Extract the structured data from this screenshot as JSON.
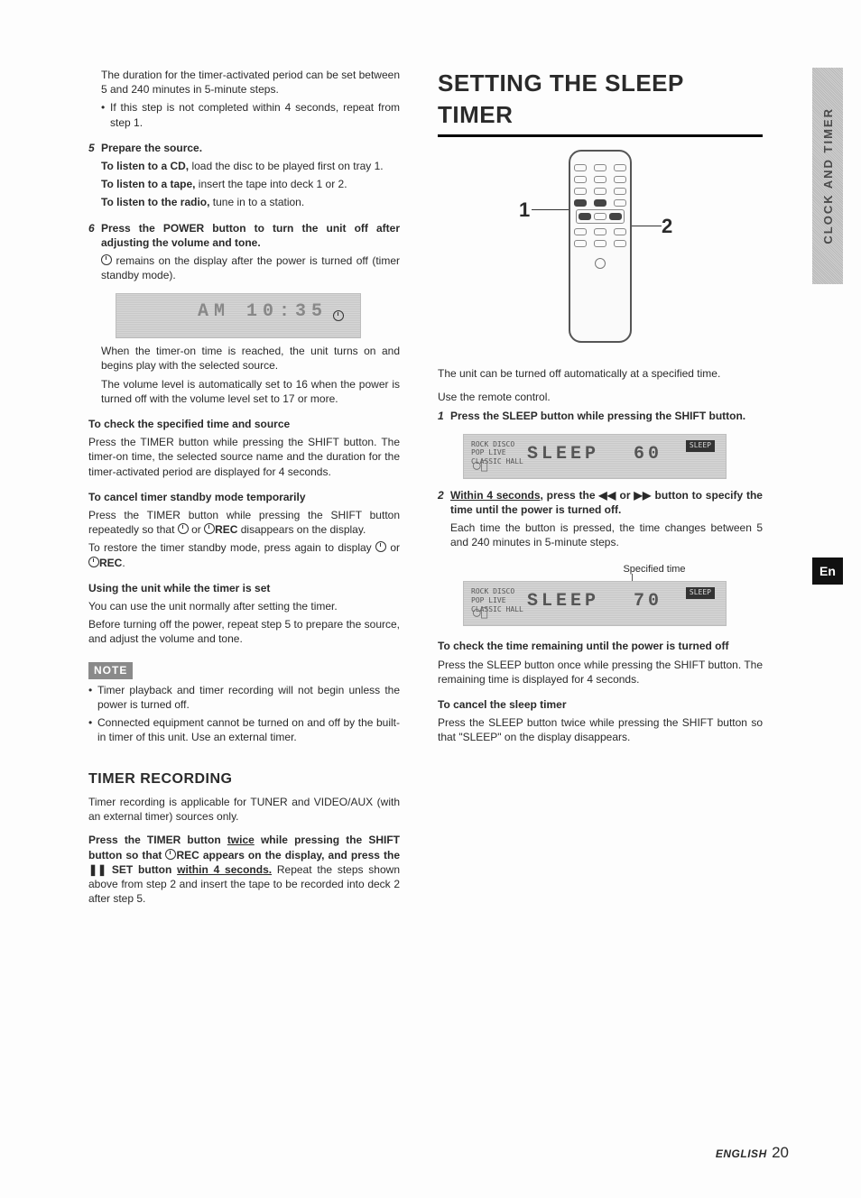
{
  "left": {
    "intro": "The duration for the timer-activated period can be set between 5 and 240 minutes in 5-minute steps.",
    "intro_bullet": "If this step is not completed within 4 seconds, repeat from step 1.",
    "step5_num": "5",
    "step5_head": "Prepare the source.",
    "step5_cd_b": "To listen to a CD,",
    "step5_cd": " load the disc to be played first on tray 1.",
    "step5_tape_b": "To listen to a tape,",
    "step5_tape": " insert the tape into deck 1 or 2.",
    "step5_radio_b": "To listen to the radio,",
    "step5_radio": " tune in to a station.",
    "step6_num": "6",
    "step6_head": "Press the POWER button to turn the unit off after adjusting the volume and tone.",
    "step6_body": " remains on the display after the power is turned off (timer standby mode).",
    "lcd1_text": "AM 10:35",
    "after6_p1": "When the timer-on time is reached, the unit turns on and begins play with the selected source.",
    "after6_p2": "The volume level is automatically set to 16 when the power is turned off with the volume level set to 17 or more.",
    "check_head": "To check the specified time and source",
    "check_body": "Press the TIMER button while pressing the SHIFT button. The timer-on time, the selected source name and the duration for the timer-activated period are displayed for 4 seconds.",
    "cancel_head": "To cancel timer standby mode temporarily",
    "cancel_p1a": "Press the TIMER button while pressing the SHIFT button repeatedly so that ",
    "cancel_p1b": " or ",
    "cancel_rec1": "REC",
    "cancel_p1c": " disappears on the display.",
    "cancel_p2a": "To restore the timer standby mode, press again to display ",
    "cancel_p2b": " or ",
    "cancel_rec2": "REC",
    "cancel_p2c": ".",
    "using_head": "Using the unit while the timer is set",
    "using_p1": "You can use the unit normally after setting the timer.",
    "using_p2": "Before turning off the power, repeat step 5 to prepare the source, and adjust the volume and tone.",
    "note_label": "NOTE",
    "note_b1": "Timer playback and timer recording will not begin unless the power is turned off.",
    "note_b2": "Connected equipment cannot be turned on and off by the built-in timer of this unit.  Use an external timer.",
    "tr_title": "TIMER RECORDING",
    "tr_p1": "Timer recording is applicable for TUNER and VIDEO/AUX (with an external timer) sources only.",
    "tr_p2a": "Press the TIMER button ",
    "tr_twice": "twice",
    "tr_p2b": " while pressing the SHIFT button so that ",
    "tr_rec": "REC",
    "tr_p2c": " appears on the display, and press the ",
    "tr_pause": "❚❚",
    "tr_set": " SET button ",
    "tr_within": "within 4 seconds.",
    "tr_p2d": "  Repeat the steps shown above from step 2 and insert the tape to be recorded into deck 2 after step 5."
  },
  "right": {
    "title": "SETTING THE SLEEP TIMER",
    "callout1": "1",
    "callout2": "2",
    "intro": "The unit can be turned off automatically at a specified time.",
    "use_remote": "Use the remote control.",
    "s1_num": "1",
    "s1_head": "Press the SLEEP button while pressing the SHIFT button.",
    "lcd2_left_modes": "ROCK DISCO\nPOP LIVE\nCLASSIC HALL",
    "lcd2_seg_a": "SLEEP",
    "lcd2_seg_b": "60",
    "lcd2_badge": "SLEEP",
    "s2_num": "2",
    "s2_head_a": "Within 4 seconds,",
    "s2_head_b": " press the ",
    "s2_rev": "◀◀",
    "s2_or": " or ",
    "s2_fwd": "▶▶",
    "s2_head_c": " button to specify the time until the power is turned off.",
    "s2_body": "Each time the button is pressed, the time changes between 5 and 240 minutes in 5-minute steps.",
    "spec_time": "Specified time",
    "lcd3_seg_a": "SLEEP",
    "lcd3_seg_b": "70",
    "check2_head": "To check the time remaining until the power is turned off",
    "check2_body": "Press the SLEEP button once while pressing the SHIFT button. The remaining time is displayed for 4 seconds.",
    "cancel2_head": "To cancel the sleep timer",
    "cancel2_body": "Press the SLEEP button twice while pressing the SHIFT button so that \"SLEEP\" on the display disappears."
  },
  "side_tab": "CLOCK AND TIMER",
  "en_tab": "En",
  "footer_lang": "ENGLISH",
  "footer_page": "20"
}
